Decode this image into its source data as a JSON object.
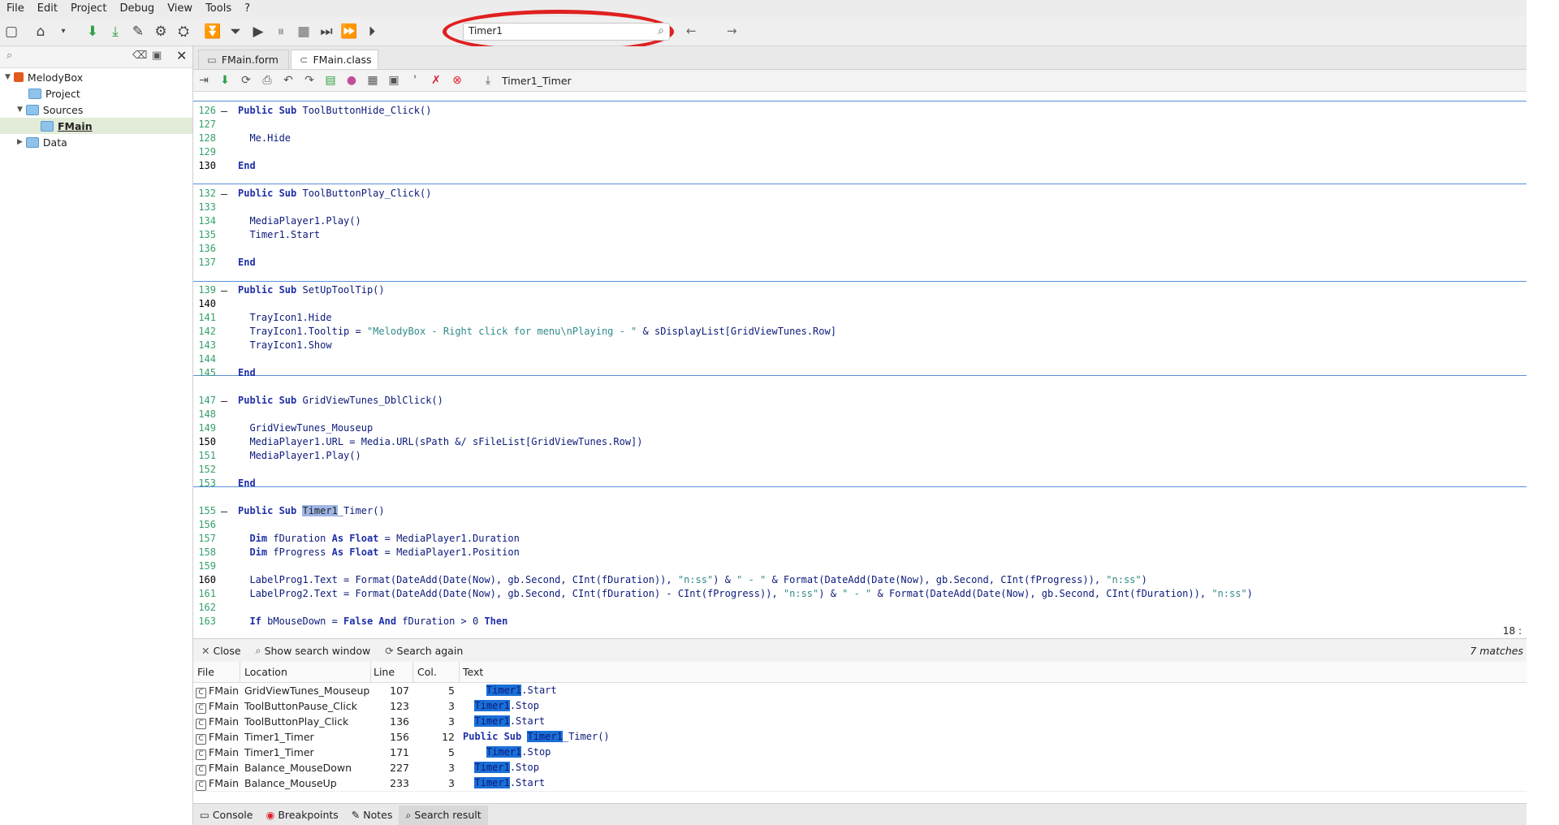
{
  "menu": [
    "File",
    "Edit",
    "Project",
    "Debug",
    "View",
    "Tools",
    "?"
  ],
  "search": {
    "value": "Timer1"
  },
  "project_tree": {
    "root": "MelodyBox",
    "items": [
      "Project",
      "Sources",
      "FMain",
      "Data"
    ]
  },
  "tabs": [
    "FMain.form",
    "FMain.class"
  ],
  "editor_toolbar": {
    "procedure": "Timer1_Timer"
  },
  "code_lines": [
    {
      "n": "126",
      "tokens": [
        [
          "kw",
          "Public Sub "
        ],
        [
          "id",
          "ToolButtonHide_Click()"
        ]
      ]
    },
    {
      "n": "127",
      "tokens": []
    },
    {
      "n": "128",
      "tokens": [
        [
          "id",
          "  Me.Hide"
        ]
      ]
    },
    {
      "n": "129",
      "tokens": []
    },
    {
      "n": "130",
      "tokens": [
        [
          "kw",
          "End"
        ]
      ],
      "current": true
    },
    {
      "n": "132",
      "tokens": [
        [
          "kw",
          "Public Sub "
        ],
        [
          "id",
          "ToolButtonPlay_Click()"
        ]
      ]
    },
    {
      "n": "133",
      "tokens": []
    },
    {
      "n": "134",
      "tokens": [
        [
          "id",
          "  MediaPlayer1.Play()"
        ]
      ]
    },
    {
      "n": "135",
      "tokens": [
        [
          "id",
          "  Timer1.Start"
        ]
      ]
    },
    {
      "n": "136",
      "tokens": []
    },
    {
      "n": "137",
      "tokens": [
        [
          "kw",
          "End"
        ]
      ]
    },
    {
      "n": "139",
      "tokens": [
        [
          "kw",
          "Public Sub "
        ],
        [
          "id",
          "SetUpToolTip()"
        ]
      ]
    },
    {
      "n": "140",
      "tokens": [],
      "current": true
    },
    {
      "n": "141",
      "tokens": [
        [
          "id",
          "  TrayIcon1.Hide"
        ]
      ]
    },
    {
      "n": "142",
      "tokens": [
        [
          "id",
          "  TrayIcon1.Tooltip = "
        ],
        [
          "str",
          "\"MelodyBox - Right click for menu\\nPlaying - \""
        ],
        [
          "id",
          " & sDisplayList[GridViewTunes.Row]"
        ]
      ]
    },
    {
      "n": "143",
      "tokens": [
        [
          "id",
          "  TrayIcon1.Show"
        ]
      ]
    },
    {
      "n": "144",
      "tokens": []
    },
    {
      "n": "145",
      "tokens": [
        [
          "kw",
          "End"
        ]
      ]
    },
    {
      "n": "147",
      "tokens": [
        [
          "kw",
          "Public Sub "
        ],
        [
          "id",
          "GridViewTunes_DblClick()"
        ]
      ]
    },
    {
      "n": "148",
      "tokens": []
    },
    {
      "n": "149",
      "tokens": [
        [
          "id",
          "  GridViewTunes_Mouseup"
        ]
      ]
    },
    {
      "n": "150",
      "tokens": [
        [
          "id",
          "  MediaPlayer1.URL = Media.URL(sPath &/ sFileList[GridViewTunes.Row])"
        ]
      ],
      "current": true
    },
    {
      "n": "151",
      "tokens": [
        [
          "id",
          "  MediaPlayer1.Play()"
        ]
      ]
    },
    {
      "n": "152",
      "tokens": []
    },
    {
      "n": "153",
      "tokens": [
        [
          "kw",
          "End"
        ]
      ]
    },
    {
      "n": "155",
      "tokens": [
        [
          "kw",
          "Public Sub "
        ],
        [
          "hl",
          "Timer1"
        ],
        [
          "id",
          "_Timer()"
        ]
      ]
    },
    {
      "n": "156",
      "tokens": []
    },
    {
      "n": "157",
      "tokens": [
        [
          "kw",
          "  Dim "
        ],
        [
          "id",
          "fDuration "
        ],
        [
          "kw",
          "As Float"
        ],
        [
          "id",
          " = MediaPlayer1.Duration"
        ]
      ]
    },
    {
      "n": "158",
      "tokens": [
        [
          "kw",
          "  Dim "
        ],
        [
          "id",
          "fProgress "
        ],
        [
          "kw",
          "As Float"
        ],
        [
          "id",
          " = MediaPlayer1.Position"
        ]
      ]
    },
    {
      "n": "159",
      "tokens": []
    },
    {
      "n": "160",
      "tokens": [
        [
          "id",
          "  LabelProg1.Text = Format(DateAdd(Date(Now), gb.Second, CInt(fDuration)), "
        ],
        [
          "str",
          "\"n:ss\""
        ],
        [
          "id",
          ") & "
        ],
        [
          "str",
          "\" - \""
        ],
        [
          "id",
          " & Format(DateAdd(Date(Now), gb.Second, CInt(fProgress)), "
        ],
        [
          "str",
          "\"n:ss\""
        ],
        [
          "id",
          ")"
        ]
      ],
      "current": true
    },
    {
      "n": "161",
      "tokens": [
        [
          "id",
          "  LabelProg2.Text = Format(DateAdd(Date(Now), gb.Second, CInt(fDuration) - CInt(fProgress)), "
        ],
        [
          "str",
          "\"n:ss\""
        ],
        [
          "id",
          ") & "
        ],
        [
          "str",
          "\" - \""
        ],
        [
          "id",
          " & Format(DateAdd(Date(Now), gb.Second, CInt(fDuration)), "
        ],
        [
          "str",
          "\"n:ss\""
        ],
        [
          "id",
          ")"
        ]
      ]
    },
    {
      "n": "162",
      "tokens": []
    },
    {
      "n": "163",
      "tokens": [
        [
          "kw",
          "  If "
        ],
        [
          "id",
          "bMouseDown = "
        ],
        [
          "kw",
          "False And "
        ],
        [
          "id",
          "fDuration > 0 "
        ],
        [
          "kw",
          "Then"
        ]
      ]
    }
  ],
  "cursor_pos": "18 :",
  "results_toolbar": {
    "close": "Close",
    "show_search": "Show search window",
    "search_again": "Search again",
    "matches": "7 matches"
  },
  "results_columns": [
    "File",
    "Location",
    "Line",
    "Col.",
    "Text"
  ],
  "results": [
    {
      "file": "FMain",
      "location": "GridViewTunes_Mouseup",
      "line": "107",
      "col": "5",
      "pre": "    ",
      "match": "Timer1",
      "post": ".Start"
    },
    {
      "file": "FMain",
      "location": "ToolButtonPause_Click",
      "line": "123",
      "col": "3",
      "pre": "  ",
      "match": "Timer1",
      "post": ".Stop"
    },
    {
      "file": "FMain",
      "location": "ToolButtonPlay_Click",
      "line": "136",
      "col": "3",
      "pre": "  ",
      "match": "Timer1",
      "post": ".Start"
    },
    {
      "file": "FMain",
      "location": "Timer1_Timer",
      "line": "156",
      "col": "12",
      "pre": "Public Sub ",
      "match": "Timer1",
      "post": "_Timer()"
    },
    {
      "file": "FMain",
      "location": "Timer1_Timer",
      "line": "171",
      "col": "5",
      "pre": "    ",
      "match": "Timer1",
      "post": ".Stop"
    },
    {
      "file": "FMain",
      "location": "Balance_MouseDown",
      "line": "227",
      "col": "3",
      "pre": "  ",
      "match": "Timer1",
      "post": ".Stop"
    },
    {
      "file": "FMain",
      "location": "Balance_MouseUp",
      "line": "233",
      "col": "3",
      "pre": "  ",
      "match": "Timer1",
      "post": ".Start"
    }
  ],
  "bottom_tabs": [
    "Console",
    "Breakpoints",
    "Notes",
    "Search result"
  ]
}
